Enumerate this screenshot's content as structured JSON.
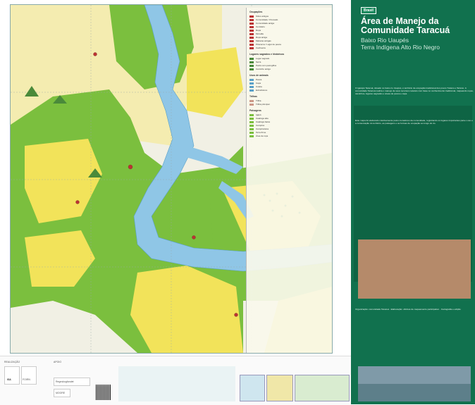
{
  "map": {
    "title": "Área de Manejo da Comunidade Taracuá",
    "subtitle_1": "Baixo Rio Uaupés",
    "subtitle_2": "Terra Indígena Alto Rio Negro",
    "publisher_badge": "Brasil",
    "colors": {
      "river": "#8fc6e6",
      "forest": "#7bbf3e",
      "cerrado": "#f2e35a",
      "campina": "#f4ecb0",
      "panel": "#11714e"
    }
  },
  "legend": {
    "sections": [
      {
        "heading": "Ocupações",
        "items": [
          "Sítios antigos",
          "Comunidade / Povoado",
          "Comunidade antiga",
          "Cemitério",
          "Roça",
          "Moradia",
          "Roça antiga",
          "Malocas antigas",
          "Piracema / Lugar de pesca",
          "Cachoeira"
        ]
      },
      {
        "heading": "Lugares sagrados e históricos",
        "items": [
          "Lugar sagrado",
          "Serra",
          "Pedra com petroglifos",
          "Caminho antigo"
        ]
      },
      {
        "heading": "Usos de animais",
        "items": [
          "Pesca",
          "Caça",
          "Coleta",
          "Extrativismo"
        ]
      },
      {
        "heading": "Trilhas",
        "items": [
          "Trilha",
          "Trilha principal"
        ]
      },
      {
        "heading": "Paisagens",
        "items": [
          "Igapó",
          "Caatinga alta",
          "Caatinga baixa",
          "Campina",
          "Campinarana",
          "Terra firme",
          "Área de roça"
        ]
      }
    ]
  },
  "panel": {
    "intro_paragraph": "O igarapé Taracuá, situado no baixo rio Uaupés, é território de ocupação tradicional dos povos Tukano e Tariano. A comunidade Taracuá realiza o manejo de seus recursos naturais com base no conhecimento tradicional, mapeando roças, caminhos, lugares sagrados e áreas de pesca e caça.",
    "body_paragraph": "Este mapa foi elaborado coletivamente pelos moradores da comunidade, registrando os lugares importantes para o uso e a conservação do território, as paisagens e as formas de ocupação ao longo do rio.",
    "credits": "Organização: comunidade Taracuá · Elaboração: oficinas de mapeamento participativo · Cartografia e edição"
  },
  "bottom": {
    "realizacao_label": "REALIZAÇÃO",
    "apoio_label": "APOIO",
    "logos": [
      "ISA",
      "FOIRN",
      "Regnskogfondet",
      "MOORE"
    ]
  }
}
